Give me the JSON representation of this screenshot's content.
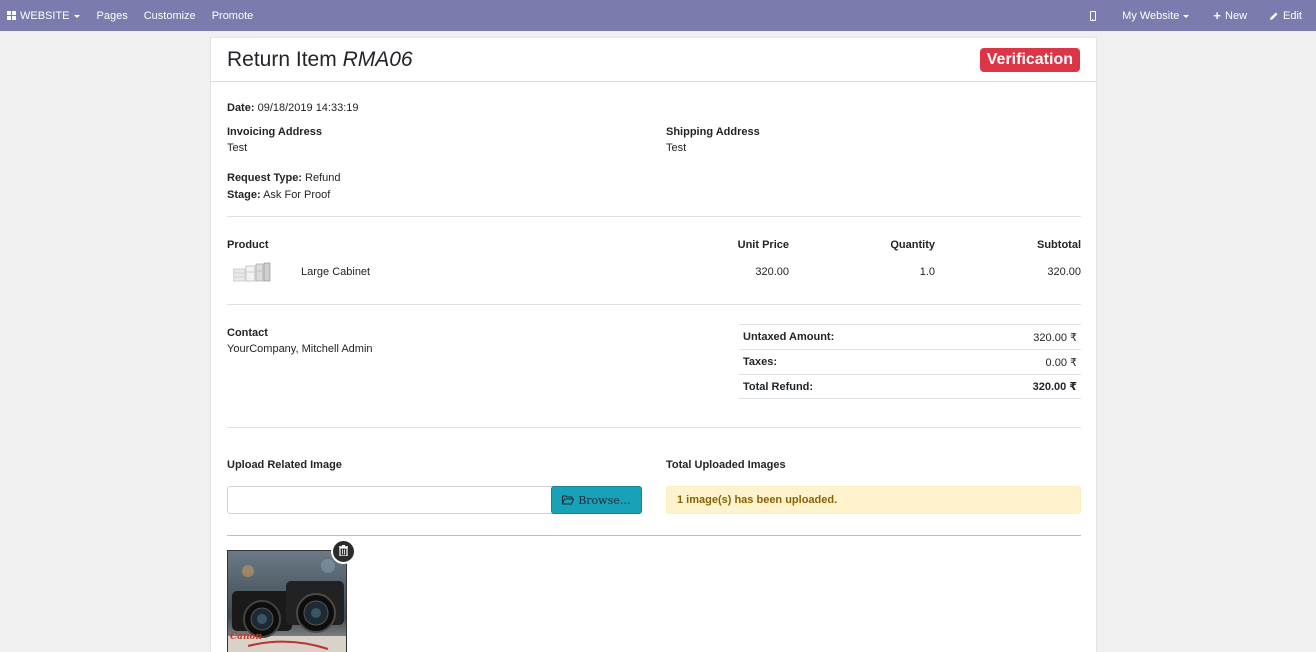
{
  "navbar": {
    "brand": "WEBSITE",
    "items": [
      "Pages",
      "Customize",
      "Promote"
    ],
    "website_selector": "My Website",
    "new_label": "New",
    "edit_label": "Edit",
    "bg_color": "#7c7bad"
  },
  "header": {
    "title_prefix": "Return Item",
    "title_ref": "RMA06",
    "status_badge": "Verification",
    "badge_color": "#dc3545"
  },
  "details": {
    "date_label": "Date:",
    "date_value": "09/18/2019 14:33:19",
    "invoicing_label": "Invoicing Address",
    "invoicing_value": "Test",
    "shipping_label": "Shipping Address",
    "shipping_value": "Test",
    "request_type_label": "Request Type:",
    "request_type_value": "Refund",
    "stage_label": "Stage:",
    "stage_value": "Ask For Proof"
  },
  "products_table": {
    "headers": [
      "Product",
      "Unit Price",
      "Quantity",
      "Subtotal"
    ],
    "rows": [
      {
        "name": "Large Cabinet",
        "unit_price": "320.00",
        "quantity": "1.0",
        "subtotal": "320.00"
      }
    ]
  },
  "contact": {
    "label": "Contact",
    "value": "YourCompany, Mitchell Admin"
  },
  "totals": {
    "rows": [
      {
        "label": "Untaxed Amount:",
        "value": "320.00 ₹"
      },
      {
        "label": "Taxes:",
        "value": "0.00 ₹"
      },
      {
        "label": "Total Refund:",
        "value": "320.00 ₹"
      }
    ]
  },
  "upload": {
    "label": "Upload Related Image",
    "browse_label": "Browse…",
    "total_label": "Total Uploaded Images",
    "status_message": "1 image(s) has been uploaded.",
    "image_watermark": "Canon"
  }
}
